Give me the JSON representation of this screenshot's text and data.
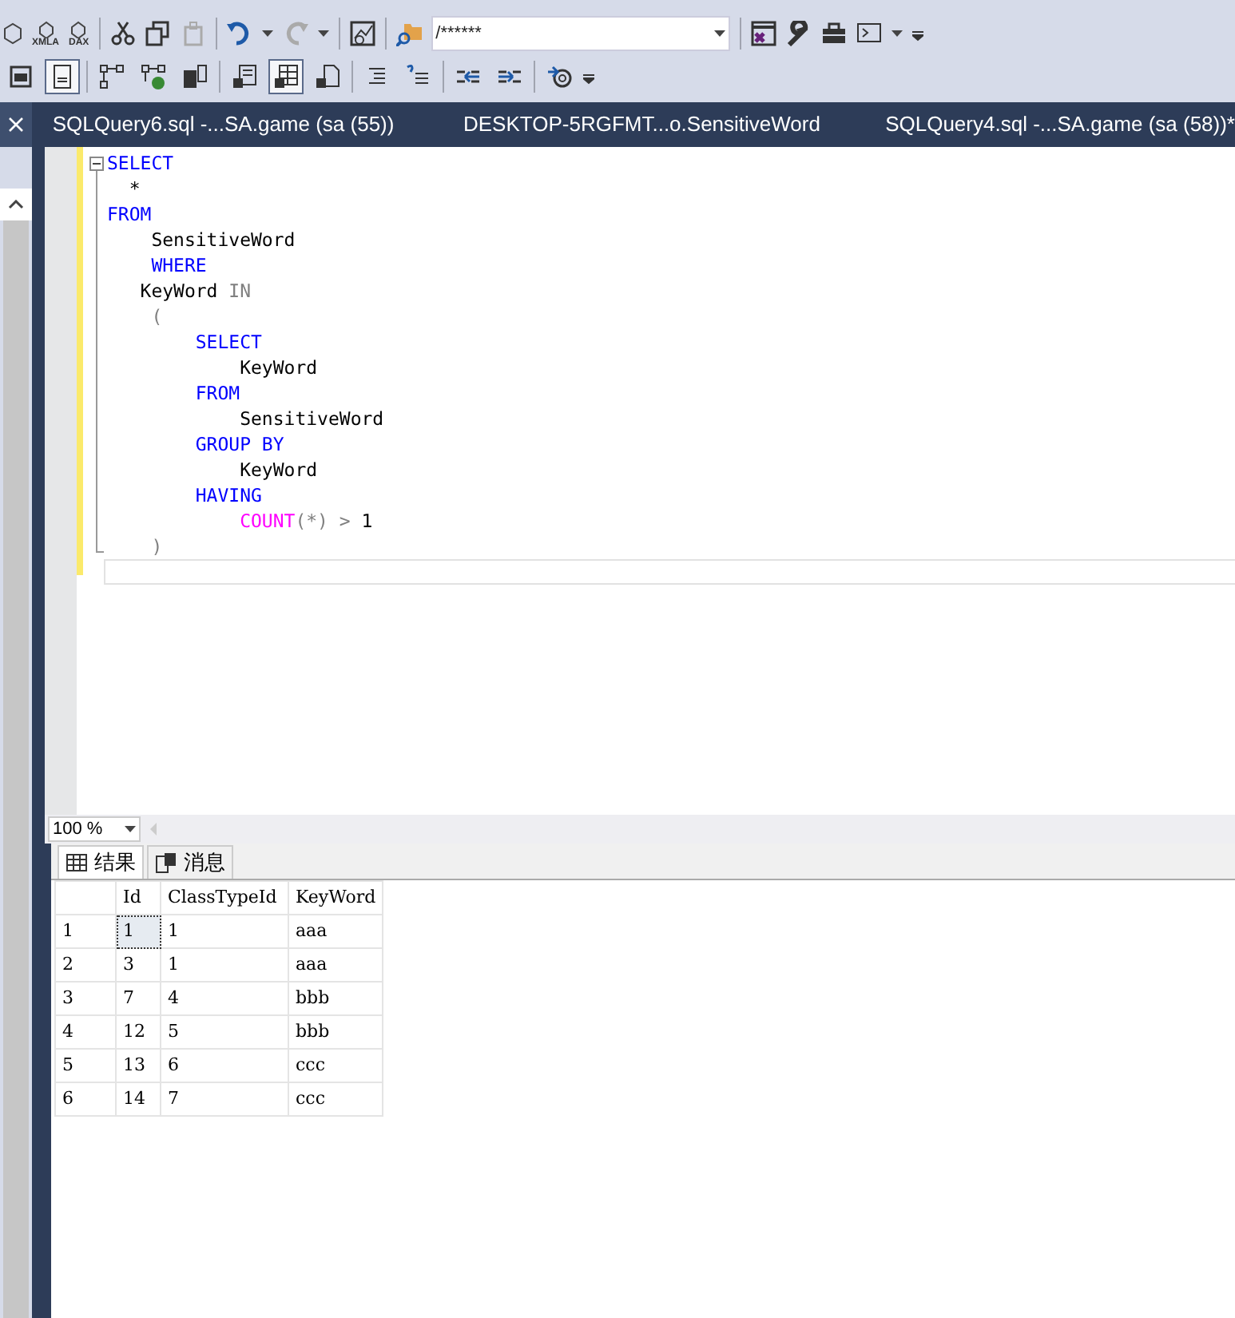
{
  "toolbar_top": {
    "icon_labels": [
      "XMLA",
      "DAX"
    ],
    "search_combo": {
      "value": "/******"
    }
  },
  "toolbar_second": [
    {
      "selected": false
    },
    {
      "selected": true
    },
    {
      "selected": false
    },
    {
      "selected": false
    },
    {
      "selected": false
    },
    {
      "selected": false
    },
    {
      "selected": true
    },
    {
      "selected": false
    },
    {
      "selected": false
    },
    {
      "selected": false
    },
    {
      "selected": false
    },
    {
      "selected": false
    },
    {
      "selected": false
    }
  ],
  "tabs": [
    {
      "label": "SQLQuery6.sql -...SA.game (sa (55))"
    },
    {
      "label": "DESKTOP-5RGFMT...o.SensitiveWord"
    },
    {
      "label": "SQLQuery4.sql -...SA.game (sa (58))*"
    }
  ],
  "editor": {
    "lines": [
      [
        {
          "kind": "keyword",
          "text": "SELECT"
        }
      ],
      [
        {
          "kind": "plain",
          "text": "  *"
        }
      ],
      [
        {
          "kind": "keyword",
          "text": "FROM"
        }
      ],
      [
        {
          "kind": "plain",
          "text": "    SensitiveWord"
        }
      ],
      [
        {
          "kind": "keyword",
          "text": "    WHERE"
        }
      ],
      [
        {
          "kind": "plain",
          "text": "   KeyWord "
        },
        {
          "kind": "operator",
          "text": "IN"
        }
      ],
      [
        {
          "kind": "operator",
          "text": "    ("
        }
      ],
      [
        {
          "kind": "keyword",
          "text": "        SELECT"
        }
      ],
      [
        {
          "kind": "plain",
          "text": "            KeyWord"
        }
      ],
      [
        {
          "kind": "keyword",
          "text": "        FROM"
        }
      ],
      [
        {
          "kind": "plain",
          "text": "            SensitiveWord"
        }
      ],
      [
        {
          "kind": "keyword",
          "text": "        GROUP BY"
        }
      ],
      [
        {
          "kind": "plain",
          "text": "            KeyWord"
        }
      ],
      [
        {
          "kind": "keyword",
          "text": "        HAVING"
        }
      ],
      [
        {
          "kind": "function",
          "text": "            COUNT"
        },
        {
          "kind": "operator",
          "text": "(*) > "
        },
        {
          "kind": "plain",
          "text": "1"
        }
      ],
      [
        {
          "kind": "operator",
          "text": "    )"
        }
      ]
    ]
  },
  "zoom": {
    "value": "100 %"
  },
  "result_tabs": [
    {
      "label": "结果",
      "selected": true
    },
    {
      "label": "消息",
      "selected": false
    }
  ],
  "results": {
    "columns": [
      "Id",
      "ClassTypeId",
      "KeyWord"
    ],
    "rows": [
      {
        "number": "1",
        "cells": [
          {
            "text": "1",
            "selected": true
          },
          {
            "text": "1",
            "selected": false
          },
          {
            "text": "aaa",
            "selected": false
          }
        ]
      },
      {
        "number": "2",
        "cells": [
          {
            "text": "3",
            "selected": false
          },
          {
            "text": "1",
            "selected": false
          },
          {
            "text": "aaa",
            "selected": false
          }
        ]
      },
      {
        "number": "3",
        "cells": [
          {
            "text": "7",
            "selected": false
          },
          {
            "text": "4",
            "selected": false
          },
          {
            "text": "bbb",
            "selected": false
          }
        ]
      },
      {
        "number": "4",
        "cells": [
          {
            "text": "12",
            "selected": false
          },
          {
            "text": "5",
            "selected": false
          },
          {
            "text": "bbb",
            "selected": false
          }
        ]
      },
      {
        "number": "5",
        "cells": [
          {
            "text": "13",
            "selected": false
          },
          {
            "text": "6",
            "selected": false
          },
          {
            "text": "ccc",
            "selected": false
          }
        ]
      },
      {
        "number": "6",
        "cells": [
          {
            "text": "14",
            "selected": false
          },
          {
            "text": "7",
            "selected": false
          },
          {
            "text": "ccc",
            "selected": false
          }
        ]
      }
    ]
  }
}
